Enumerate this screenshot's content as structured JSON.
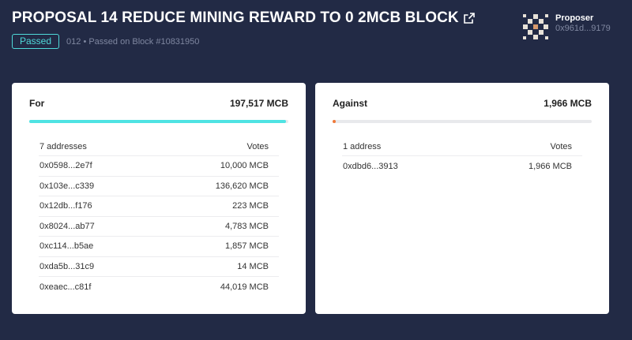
{
  "proposal": {
    "title": "PROPOSAL 14 REDUCE MINING REWARD TO 0 2MCB BLOCK",
    "status": "Passed",
    "meta": "012 • Passed on Block #10831950"
  },
  "proposer": {
    "label": "Proposer",
    "address": "0x961d...9179"
  },
  "for": {
    "label": "For",
    "total": "197,517 MCB",
    "fraction": 0.9901,
    "color": "#4fe3e3",
    "col_address": "7 addresses",
    "col_votes": "Votes",
    "rows": [
      {
        "address": "0x0598...2e7f",
        "votes": "10,000 MCB"
      },
      {
        "address": "0x103e...c339",
        "votes": "136,620 MCB"
      },
      {
        "address": "0x12db...f176",
        "votes": "223 MCB"
      },
      {
        "address": "0x8024...ab77",
        "votes": "4,783 MCB"
      },
      {
        "address": "0xc114...b5ae",
        "votes": "1,857 MCB"
      },
      {
        "address": "0xda5b...31c9",
        "votes": "14 MCB"
      },
      {
        "address": "0xeaec...c81f",
        "votes": "44,019 MCB"
      }
    ]
  },
  "against": {
    "label": "Against",
    "total": "1,966 MCB",
    "fraction": 0.0099,
    "color": "#f07a3a",
    "col_address": "1 address",
    "col_votes": "Votes",
    "rows": [
      {
        "address": "0xdbd6...3913",
        "votes": "1,966 MCB"
      }
    ]
  },
  "icons": {
    "external_link": "external-link-icon",
    "avatar": "identicon"
  }
}
